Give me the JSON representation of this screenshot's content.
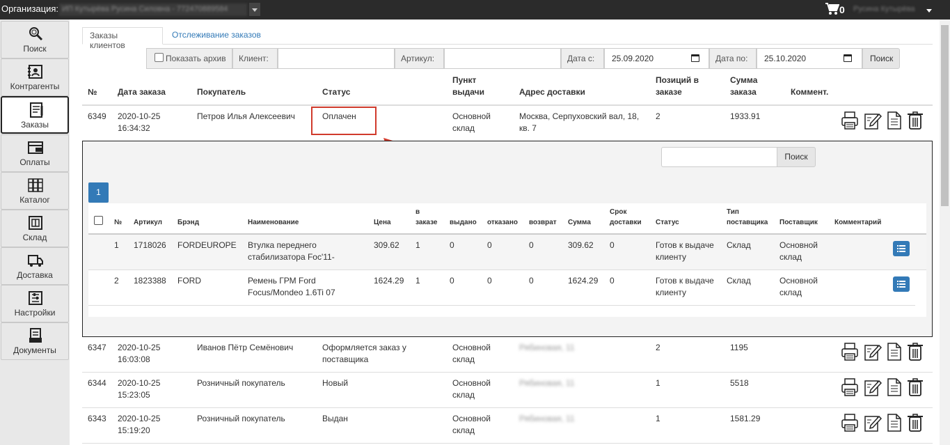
{
  "topbar": {
    "org_label": "Организация:",
    "org_value": "ИП Кутырёва Русина Силовна - 772470889584",
    "cart_count": "0",
    "user_name": "Русина Кутырёва"
  },
  "sidebar": {
    "items": [
      {
        "label": "Поиск",
        "icon": "magnifier-icon"
      },
      {
        "label": "Контрагенты",
        "icon": "contacts-icon"
      },
      {
        "label": "Заказы",
        "icon": "orders-icon",
        "active": true
      },
      {
        "label": "Оплаты",
        "icon": "payment-icon"
      },
      {
        "label": "Каталог",
        "icon": "catalog-icon"
      },
      {
        "label": "Склад",
        "icon": "warehouse-icon"
      },
      {
        "label": "Доставка",
        "icon": "delivery-icon"
      },
      {
        "label": "Настройки",
        "icon": "settings-icon"
      },
      {
        "label": "Документы",
        "icon": "documents-icon"
      }
    ]
  },
  "tabs": {
    "customer_orders": "Заказы клиентов",
    "order_tracking": "Отслеживание заказов"
  },
  "filters": {
    "show_archive": "Показать архив",
    "client_label": "Клиент:",
    "client_value": "",
    "article_label": "Артикул:",
    "article_value": "",
    "date_from_label": "Дата с:",
    "date_from": "25.09.2020",
    "date_to_label": "Дата по:",
    "date_to": "25.10.2020",
    "search_button": "Поиск"
  },
  "orders_table": {
    "headers": {
      "num": "№",
      "date": "Дата заказа",
      "buyer": "Покупатель",
      "status": "Статус",
      "pickup_1": "Пункт",
      "pickup_2": "выдачи",
      "address": "Адрес доставки",
      "positions_1": "Позиций в",
      "positions_2": "заказе",
      "sum_1": "Сумма",
      "sum_2": "заказа",
      "comment": "Коммент."
    },
    "rows": [
      {
        "num": "6349",
        "date": "2020-10-25",
        "time": "16:34:32",
        "buyer": "Петров Илья Алексеевич",
        "status_1": "Оплачен",
        "status_2": "",
        "pickup_1": "Основной",
        "pickup_2": "склад",
        "address_1": "Москва, Серпуховский вал, 18,",
        "address_2": "кв. 7",
        "positions": "2",
        "sum": "1933.91"
      },
      {
        "num": "6347",
        "date": "2020-10-25",
        "time": "16:03:08",
        "buyer": "Иванов Пётр Семёнович",
        "status_1": "Оформляется заказ у",
        "status_2": "поставщика",
        "pickup_1": "Основной",
        "pickup_2": "склад",
        "address_1": "Рябиновая, 11",
        "address_2": "",
        "positions": "2",
        "sum": "1195"
      },
      {
        "num": "6344",
        "date": "2020-10-25",
        "time": "15:23:05",
        "buyer": "Розничный покупатель",
        "status_1": "Новый",
        "status_2": "",
        "pickup_1": "Основной",
        "pickup_2": "склад",
        "address_1": "Рябиновая, 11",
        "address_2": "",
        "positions": "1",
        "sum": "5518"
      },
      {
        "num": "6343",
        "date": "2020-10-25",
        "time": "15:19:20",
        "buyer": "Розничный покупатель",
        "status_1": "Выдан",
        "status_2": "",
        "pickup_1": "Основной",
        "pickup_2": "склад",
        "address_1": "Рябиновая, 11",
        "address_2": "",
        "positions": "1",
        "sum": "1581.29"
      }
    ]
  },
  "detail": {
    "search_value": "",
    "search_button": "Поиск",
    "page": "1",
    "headers": {
      "num": "№",
      "article": "Артикул",
      "brand": "Брэнд",
      "name": "Наименование",
      "price": "Цена",
      "in_order_1": "в",
      "in_order_2": "заказе",
      "issued": "выдано",
      "refused": "отказано",
      "returned": "возврат",
      "sum": "Сумма",
      "term_1": "Срок",
      "term_2": "доставки",
      "status": "Статус",
      "supplier_type_1": "Тип",
      "supplier_type_2": "поставщика",
      "supplier": "Поставщик",
      "comment": "Комментарий"
    },
    "rows": [
      {
        "num": "1",
        "article": "1718026",
        "brand": "FORDEUROPE",
        "name_1": "Втулка переднего",
        "name_2": "стабилизатора Foc'11-",
        "price": "309.62",
        "in_order": "1",
        "issued": "0",
        "refused": "0",
        "returned": "0",
        "sum": "309.62",
        "term": "0",
        "status_1": "Готов к выдаче",
        "status_2": "клиенту",
        "supplier_type": "Склад",
        "supplier_1": "Основной",
        "supplier_2": "склад"
      },
      {
        "num": "2",
        "article": "1823388",
        "brand": "FORD",
        "name_1": "Ремень ГРМ Ford",
        "name_2": "Focus/Mondeo 1.6Ti 07",
        "price": "1624.29",
        "in_order": "1",
        "issued": "0",
        "refused": "0",
        "returned": "0",
        "sum": "1624.29",
        "term": "0",
        "status_1": "Готов к выдаче",
        "status_2": "клиенту",
        "supplier_type": "Склад",
        "supplier_1": "Основной",
        "supplier_2": "склад"
      }
    ]
  },
  "colors": {
    "accent": "#337ab7",
    "highlight": "#d03a2c",
    "topbar": "#2b2b2b"
  }
}
